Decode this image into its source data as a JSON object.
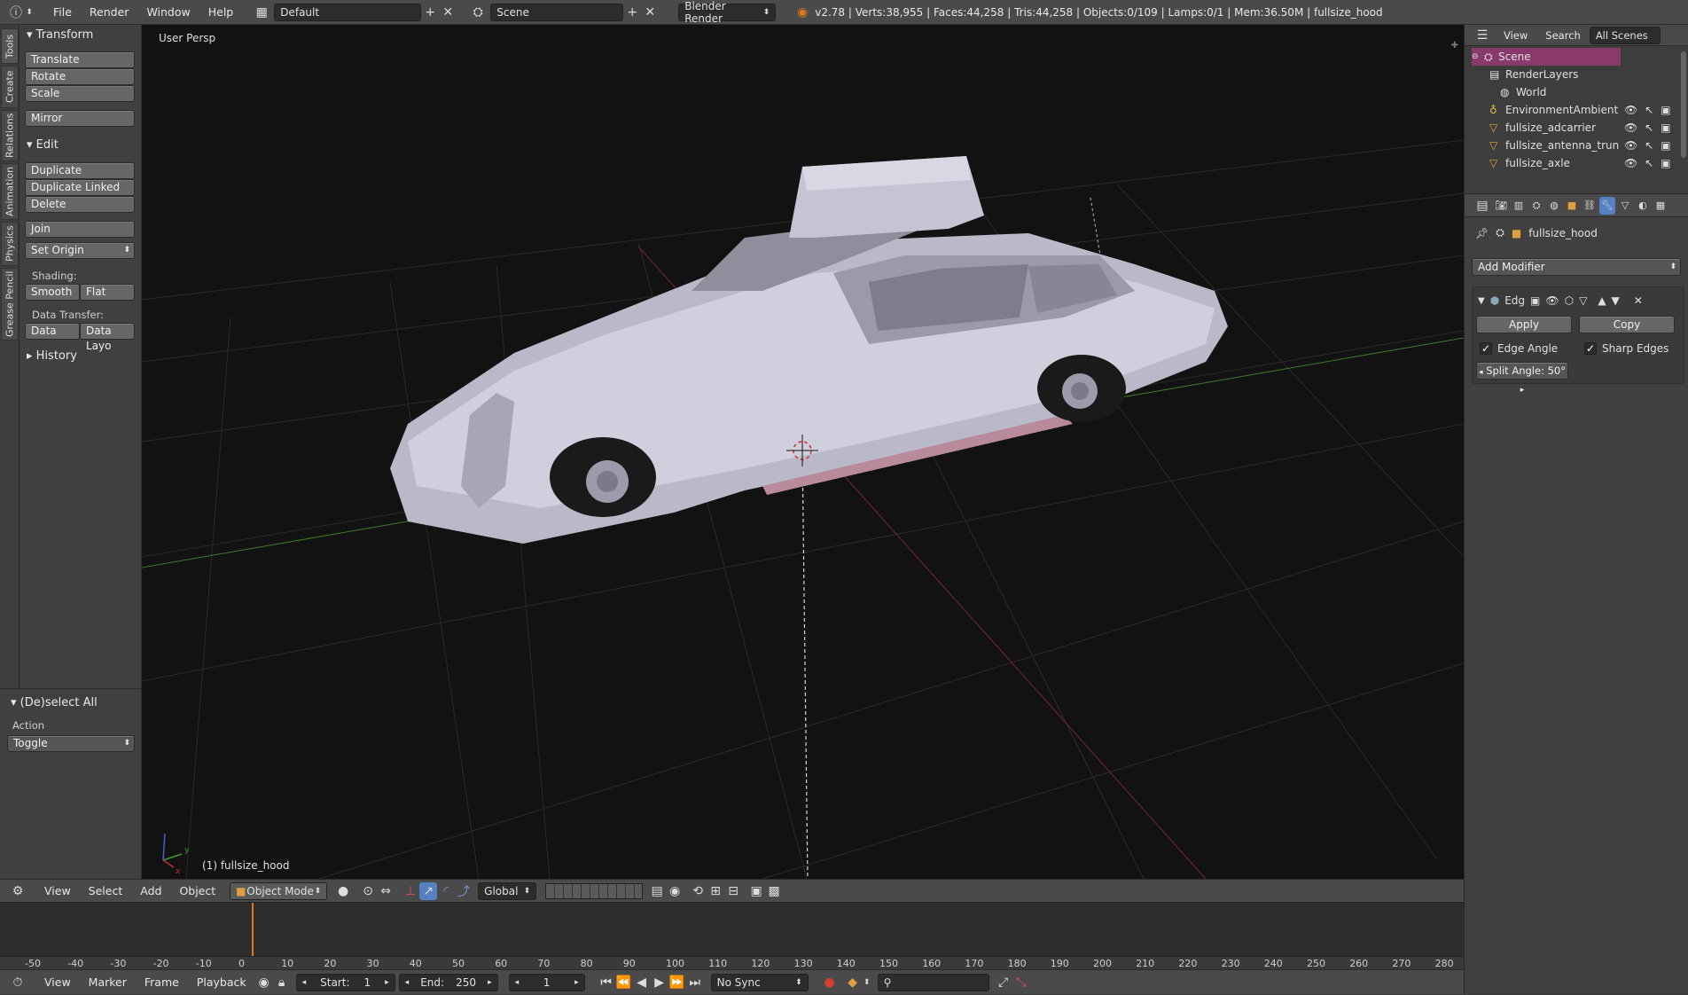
{
  "topbar": {
    "menus": [
      "File",
      "Render",
      "Window",
      "Help"
    ],
    "layout": "Default",
    "scene": "Scene",
    "engine": "Blender Render",
    "stats": "v2.78 | Verts:38,955 | Faces:44,258 | Tris:44,258 | Objects:0/109 | Lamps:0/1 | Mem:36.50M | fullsize_hood"
  },
  "tabs": [
    "Tools",
    "Create",
    "Relations",
    "Animation",
    "Physics",
    "Grease Pencil"
  ],
  "toolshelf": {
    "transform_title": "Transform",
    "translate": "Translate",
    "rotate": "Rotate",
    "scale": "Scale",
    "mirror": "Mirror",
    "edit_title": "Edit",
    "duplicate": "Duplicate",
    "duplicate_linked": "Duplicate Linked",
    "delete": "Delete",
    "join": "Join",
    "set_origin": "Set Origin",
    "shading_label": "Shading:",
    "smooth": "Smooth",
    "flat": "Flat",
    "data_transfer_label": "Data Transfer:",
    "data": "Data",
    "data_layout": "Data Layo",
    "history_title": "History"
  },
  "operator": {
    "title": "(De)select All",
    "action_label": "Action",
    "action_value": "Toggle"
  },
  "viewport": {
    "view_name": "User Persp",
    "object_label": "(1) fullsize_hood",
    "axis_x": "x",
    "axis_y": "y"
  },
  "vphead": {
    "view": "View",
    "select": "Select",
    "add": "Add",
    "object": "Object",
    "mode": "Object Mode",
    "orientation": "Global"
  },
  "timeline": {
    "ticks": [
      "-50",
      "-40",
      "-30",
      "-20",
      "-10",
      "0",
      "10",
      "20",
      "30",
      "40",
      "50",
      "60",
      "70",
      "80",
      "90",
      "100",
      "110",
      "120",
      "130",
      "140",
      "150",
      "160",
      "170",
      "180",
      "190",
      "200",
      "210",
      "220",
      "230",
      "240",
      "250",
      "260",
      "270",
      "280"
    ],
    "current_frame": 1
  },
  "tlhead": {
    "view": "View",
    "marker": "Marker",
    "frame": "Frame",
    "playback": "Playback",
    "start_label": "Start:",
    "start_value": "1",
    "end_label": "End:",
    "end_value": "250",
    "current": "1",
    "sync": "No Sync"
  },
  "outliner": {
    "view": "View",
    "search": "Search",
    "filter": "All Scenes",
    "rows": [
      "Scene",
      "RenderLayers",
      "World",
      "EnvironmentAmbientLi",
      "fullsize_adcarrier",
      "fullsize_antenna_trunk",
      "fullsize_axle"
    ]
  },
  "props": {
    "object_name": "fullsize_hood",
    "add_modifier": "Add Modifier",
    "modifier_name": "Edg",
    "apply": "Apply",
    "copy": "Copy",
    "edge_angle": "Edge Angle",
    "sharp_edges": "Sharp Edges",
    "split_angle": "Split Angle: 50°"
  },
  "colors": {
    "accent": "#e07a1b",
    "selected_outline": "#8a3a6a",
    "active_tool": "#5680c2"
  }
}
